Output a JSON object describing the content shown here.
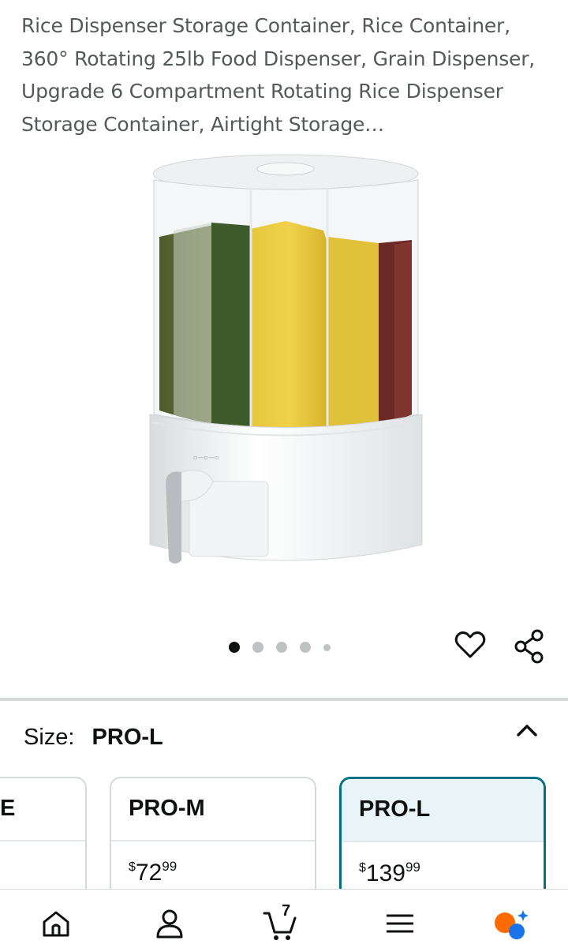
{
  "product": {
    "title": "Rice Dispenser Storage Container, Rice Container, 360° Rotating 25lb Food Dispenser, Grain Dispenser, Upgrade 6 Compartment Rotating Rice Dispenser Storage Container, Airtight Storage…",
    "image_icon": "rice-dispenser-image",
    "carousel_dots": 5,
    "carousel_active_index": 0
  },
  "actions": {
    "wishlist_icon": "heart-icon",
    "share_icon": "share-icon"
  },
  "size_selector": {
    "label": "Size:",
    "selected": "PRO-L",
    "collapse_icon": "chevron-up-icon",
    "options": [
      {
        "name": "E",
        "price_dollars": "",
        "price_cents": ""
      },
      {
        "name": "PRO-M",
        "price_symbol": "$",
        "price_dollars": "72",
        "price_cents": "99"
      },
      {
        "name": "PRO-L",
        "price_symbol": "$",
        "price_dollars": "139",
        "price_cents": "99"
      }
    ]
  },
  "bottom_nav": {
    "items": [
      {
        "icon": "home-icon"
      },
      {
        "icon": "user-icon"
      },
      {
        "icon": "cart-icon",
        "count": "7"
      },
      {
        "icon": "menu-icon"
      },
      {
        "icon": "assistant-icon"
      }
    ]
  },
  "colors": {
    "accent_teal": "#007185",
    "selected_bg": "#e8f4f8",
    "text_gray": "#565959",
    "assistant_orange": "#ff6b00",
    "assistant_blue": "#1a73e8"
  }
}
